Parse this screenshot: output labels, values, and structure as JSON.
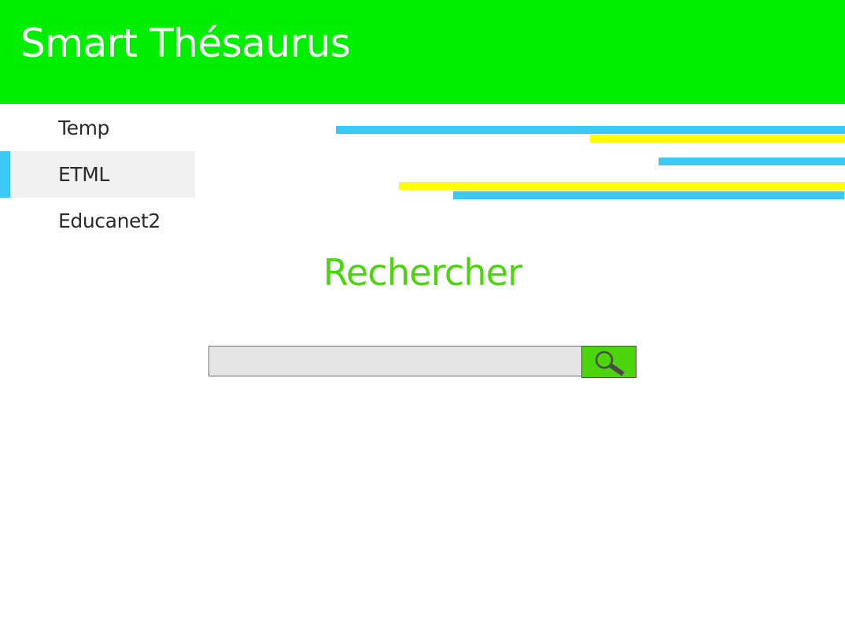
{
  "app": {
    "title": "Smart Thésaurus"
  },
  "sidebar": {
    "items": [
      {
        "label": "Temp",
        "active": false
      },
      {
        "label": "ETML",
        "active": true
      },
      {
        "label": "Educanet2",
        "active": false
      }
    ]
  },
  "search": {
    "heading": "Rechercher",
    "value": "",
    "placeholder": "",
    "button_icon": "search-icon"
  },
  "colors": {
    "header_bg": "#00ee00",
    "accent_green": "#4cd40c",
    "accent_blue": "#3cc8f5",
    "accent_yellow": "#ffff00",
    "sidebar_active_bg": "#f1f1f1"
  }
}
